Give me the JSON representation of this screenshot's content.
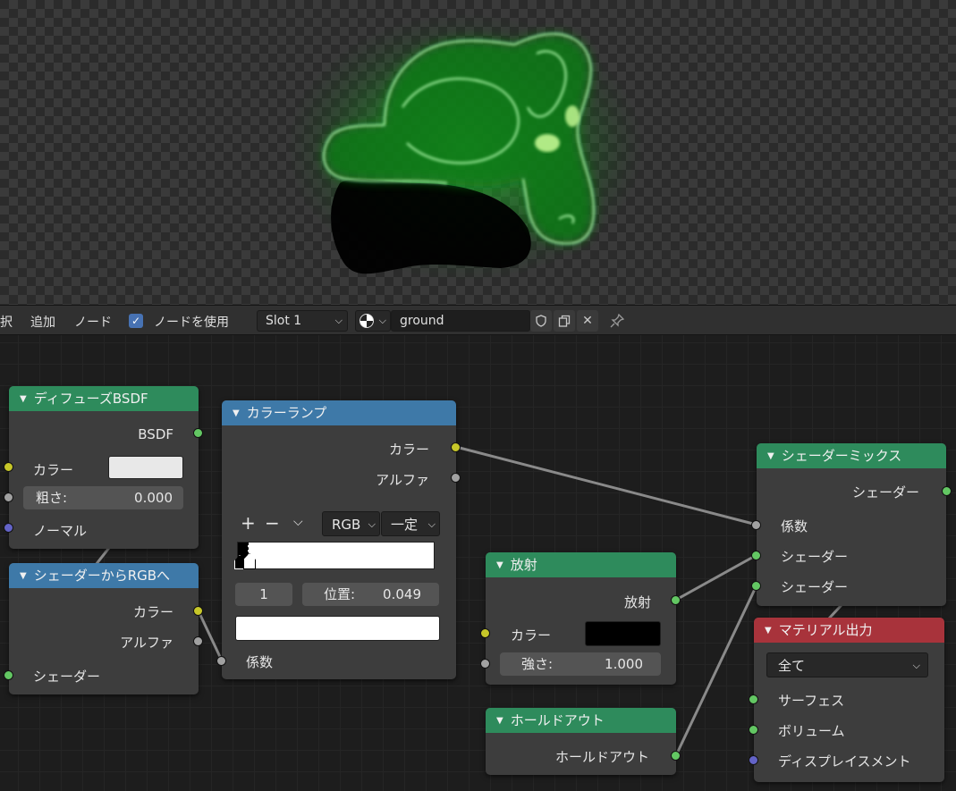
{
  "header": {
    "menu_select": "択",
    "menu_add": "追加",
    "menu_node": "ノード",
    "use_nodes_label": "ノードを使用",
    "use_nodes_checked": true,
    "slot_value": "Slot 1",
    "material_name": "ground",
    "icons": [
      "material-sphere-icon",
      "chevron-down-icon",
      "shield-icon",
      "duplicate-icon",
      "close-icon",
      "pin-icon"
    ]
  },
  "nodes": {
    "diffuse": {
      "title": "ディフューズBSDF",
      "out_bsdf": "BSDF",
      "color_label": "カラー",
      "color_value": "#e8e8e8",
      "roughness_label": "粗さ:",
      "roughness_value": "0.000",
      "normal_label": "ノーマル"
    },
    "shader_to_rgb": {
      "title": "シェーダーからRGBへ",
      "out_color": "カラー",
      "out_alpha": "アルファ",
      "in_shader": "シェーダー"
    },
    "color_ramp": {
      "title": "カラーランプ",
      "out_color": "カラー",
      "out_alpha": "アルファ",
      "add_btn": "+",
      "remove_btn": "−",
      "mode": "RGB",
      "interp": "一定",
      "stop_index": "1",
      "pos_label": "位置:",
      "pos_value": "0.049",
      "stop_color": "#ffffff",
      "in_fac": "係数"
    },
    "emission": {
      "title": "放射",
      "out_emission": "放射",
      "color_label": "カラー",
      "color_value": "#000000",
      "strength_label": "強さ:",
      "strength_value": "1.000"
    },
    "holdout": {
      "title": "ホールドアウト",
      "out_holdout": "ホールドアウト"
    },
    "mix_shader": {
      "title": "シェーダーミックス",
      "out_shader": "シェーダー",
      "in_fac": "係数",
      "in_shader1": "シェーダー",
      "in_shader2": "シェーダー"
    },
    "material_output": {
      "title": "マテリアル出力",
      "target": "全て",
      "in_surface": "サーフェス",
      "in_volume": "ボリューム",
      "in_displacement": "ディスプレイスメント"
    }
  },
  "colors": {
    "node_green": "#2e8b5c",
    "node_blue": "#3e79a8",
    "node_red": "#a8333b",
    "glow": "#39ff3a"
  }
}
